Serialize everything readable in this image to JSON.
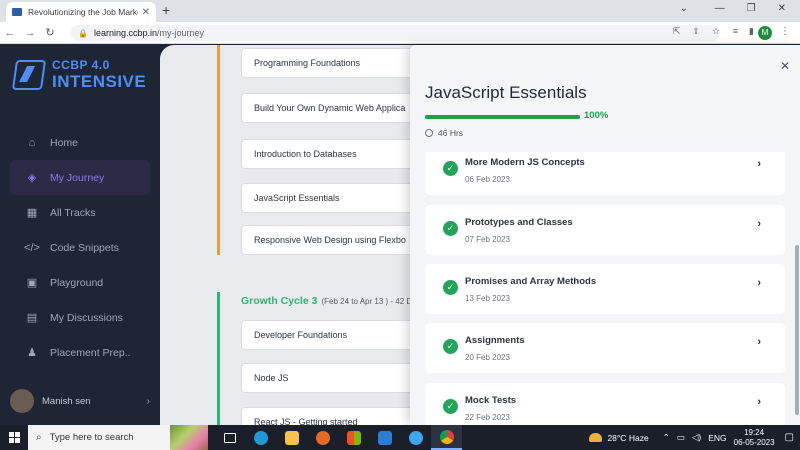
{
  "browser": {
    "tab_title": "Revolutionizing the Job Market |",
    "tab_close": "✕",
    "new_tab": "+",
    "url_host": "learning.ccbp.in",
    "url_path": "/my-journey",
    "profile_initial": "M"
  },
  "sidebar": {
    "logo_line1": "CCBP 4.0",
    "logo_line2": "INTENSIVE",
    "items": [
      {
        "label": "Home",
        "icon": "home-icon",
        "glyph": "⌂"
      },
      {
        "label": "My Journey",
        "icon": "journey-icon",
        "glyph": "◈",
        "active": true
      },
      {
        "label": "All Tracks",
        "icon": "tracks-icon",
        "glyph": "▦"
      },
      {
        "label": "Code Snippets",
        "icon": "code-icon",
        "glyph": "</>"
      },
      {
        "label": "Playground",
        "icon": "terminal-icon",
        "glyph": "▣"
      },
      {
        "label": "My Discussions",
        "icon": "discussions-icon",
        "glyph": "▤"
      },
      {
        "label": "Placement Prep..",
        "icon": "placement-icon",
        "glyph": "♟"
      }
    ],
    "user_name": "Manish sen"
  },
  "main": {
    "courses": [
      "Programming Foundations",
      "Build Your Own Dynamic Web Applica",
      "Introduction to Databases",
      "JavaScript Essentials",
      "Responsive Web Design using Flexbo"
    ],
    "cycle_title": "Growth Cycle 3",
    "cycle_sub": "(Feb 24 to Apr 13 ) - 42 D",
    "cycle_courses": [
      "Developer Foundations",
      "Node JS",
      "React JS - Getting started"
    ]
  },
  "drawer": {
    "title": "JavaScript Essentials",
    "progress_percent": 100,
    "progress_label": "100%",
    "hours": "46 Hrs",
    "topics": [
      {
        "name": "More Modern JS Concepts",
        "date": "06 Feb 2023"
      },
      {
        "name": "Prototypes and Classes",
        "date": "07 Feb 2023"
      },
      {
        "name": "Promises and Array Methods",
        "date": "13 Feb 2023"
      },
      {
        "name": "Assignments",
        "date": "20 Feb 2023"
      },
      {
        "name": "Mock Tests",
        "date": "22 Feb 2023"
      }
    ]
  },
  "taskbar": {
    "search_placeholder": "Type here to search",
    "temperature": "28°C",
    "weather": "Haze",
    "language": "ENG",
    "time": "19:24",
    "date": "06-05-2023"
  },
  "colors": {
    "accent_green": "#16a34a",
    "journey_purple": "#8a7cf0",
    "logo_blue": "#4d8ef7",
    "rail_yellow": "#e2a23b"
  }
}
